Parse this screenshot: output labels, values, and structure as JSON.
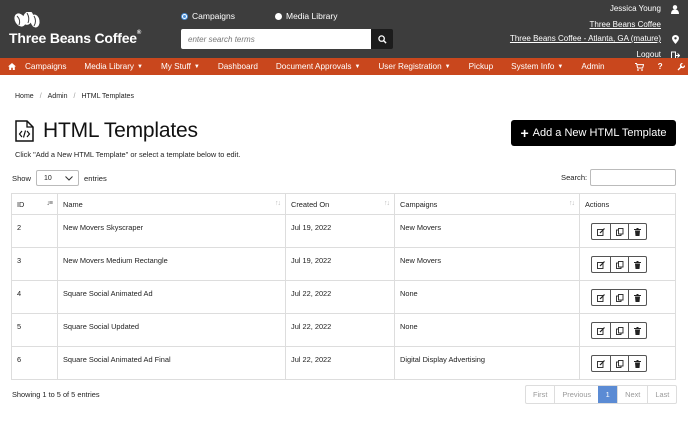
{
  "brand": {
    "name": "Three Beans Coffee",
    "tm": "®"
  },
  "header": {
    "radio_campaigns": "Campaigns",
    "radio_media": "Media Library",
    "search_placeholder": "enter search terms",
    "user_name": "Jessica Young",
    "account_name": "Three Beans Coffee",
    "location": "Three Beans Coffee - Atlanta, GA (mature)",
    "logout": "Logout"
  },
  "nav": {
    "items": [
      "Campaigns",
      "Media Library",
      "My Stuff",
      "Dashboard",
      "Document Approvals",
      "User Registration",
      "Pickup",
      "System Info",
      "Admin"
    ],
    "help": "?"
  },
  "breadcrumb": [
    "Home",
    "Admin",
    "HTML Templates"
  ],
  "page": {
    "title": "HTML Templates",
    "subtitle": "Click \"Add a New HTML Template\" or select a template below to edit.",
    "add_button": "Add a New HTML Template",
    "show_label": "Show",
    "entries_label": "entries",
    "page_size": "10",
    "search_label": "Search:"
  },
  "table": {
    "columns": [
      "ID",
      "Name",
      "Created On",
      "Campaigns",
      "Actions"
    ],
    "rows": [
      {
        "id": "2",
        "name": "New Movers Skyscraper",
        "created": "Jul 19, 2022",
        "campaigns": "New Movers"
      },
      {
        "id": "3",
        "name": "New Movers Medium Rectangle",
        "created": "Jul 19, 2022",
        "campaigns": "New Movers"
      },
      {
        "id": "4",
        "name": "Square Social Animated Ad",
        "created": "Jul 22, 2022",
        "campaigns": "None"
      },
      {
        "id": "5",
        "name": "Square Social Updated",
        "created": "Jul 22, 2022",
        "campaigns": "None"
      },
      {
        "id": "6",
        "name": "Square Social Animated Ad Final",
        "created": "Jul 22, 2022",
        "campaigns": "Digital Display Advertising"
      }
    ]
  },
  "footer": {
    "info": "Showing 1 to 5 of 5 entries",
    "first": "First",
    "previous": "Previous",
    "page": "1",
    "next": "Next",
    "last": "Last"
  },
  "colors": {
    "header_bg": "#3d3d3d",
    "nav_bg": "#c9471d",
    "active_page": "#5b8bd4"
  }
}
